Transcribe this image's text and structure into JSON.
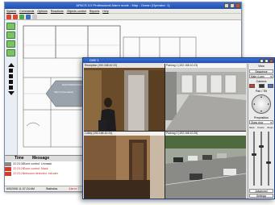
{
  "back_window": {
    "title": "APACS 3.0 Professional Alarm mode - Map - Ocean (Operator: 1)",
    "menu": [
      "System",
      "Commands",
      "Options",
      "Reactions",
      "Objects control",
      "Reports",
      "Help"
    ],
    "floorplan_labels": [
      "Main Presentation",
      "MAIN PRESENTATION"
    ],
    "log": {
      "col_time": "Time",
      "col_message": "Message",
      "rows": [
        {
          "time": "22:23:30",
          "message": "Zone control: Unmask",
          "alarm": false
        },
        {
          "time": "22:23:29",
          "message": "Zone control: Mask",
          "alarm": true
        },
        {
          "time": "22:23:24",
          "message": "Intrusion detected: Intruder",
          "alarm": true
        }
      ]
    },
    "status": {
      "datetime": "6/5/2008 11:37:24 AM",
      "statistics": "Statistics",
      "alarm": "Alarm: 7"
    }
  },
  "front_window": {
    "title": "DWE 3",
    "cameras": [
      {
        "label": "Reception (192.168.10.22)"
      },
      {
        "label": "Parking 1 (192.168.10.23)"
      },
      {
        "label": "Lobby (192.168.10.24)"
      },
      {
        "label": "Parking 2 (192.168.10.25)"
      }
    ],
    "panel": {
      "view": "View",
      "sequence": "Sequence",
      "layout": "Mate 4 cam",
      "camera": "Camera",
      "pan_tilt": "Pan / Tilt",
      "preposition": "Preposition",
      "preset": "Glass door",
      "speed_labels": [
        "Slow",
        "Focus",
        "Zoom"
      ],
      "advanced": "Advanced",
      "settings": "Settings"
    }
  }
}
